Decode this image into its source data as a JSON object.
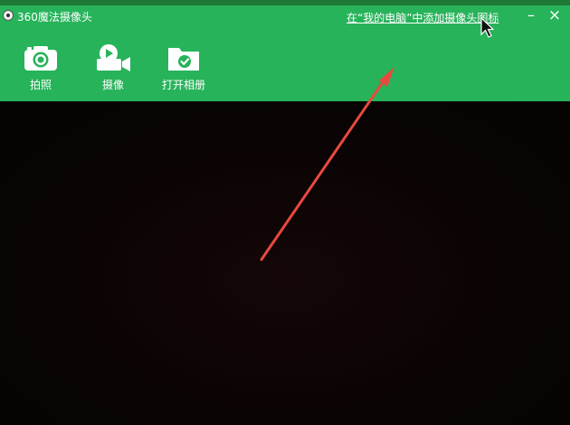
{
  "window": {
    "title": "360魔法摄像头",
    "link": "在“我的电脑”中添加摄像头图标",
    "minimize_glyph": "–",
    "close_glyph": "×"
  },
  "toolbar": {
    "items": [
      {
        "label": "拍照",
        "icon": "camera-icon"
      },
      {
        "label": "摄像",
        "icon": "video-camera-icon"
      },
      {
        "label": "打开相册",
        "icon": "folder-check-icon"
      }
    ]
  },
  "colors": {
    "toolbar_bg": "#27b35a",
    "viewport_bg": "#0b0505",
    "annotation_arrow": "#e8493f"
  }
}
